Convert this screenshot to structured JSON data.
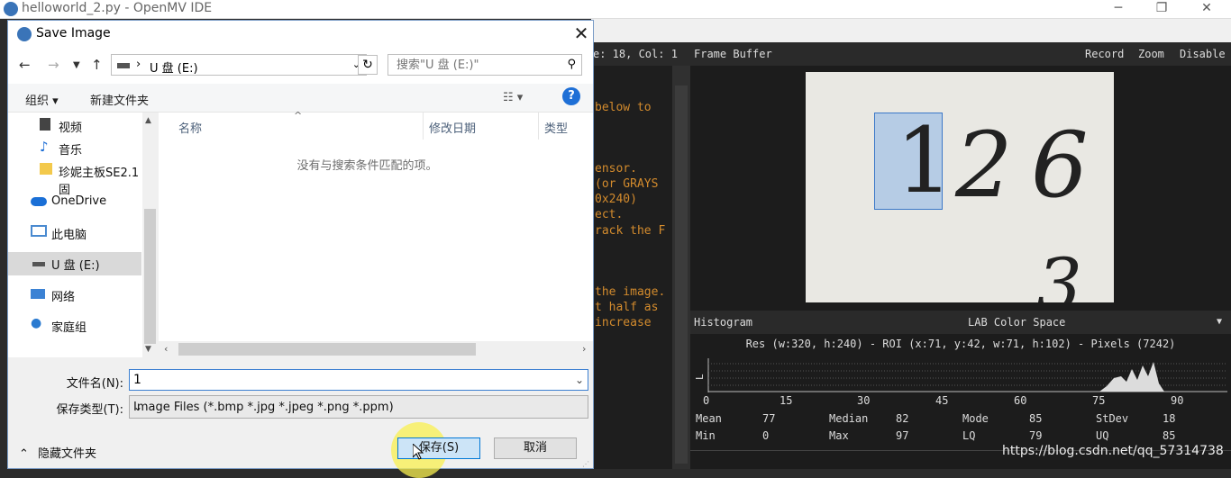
{
  "ide": {
    "title": "helloworld_2.py - OpenMV IDE",
    "status": "e: 18, Col: 1",
    "code_lines": [
      " below to",
      "ensor.",
      " (or GRAYS",
      "0x240)",
      "ect.",
      "rack the F",
      "the image.",
      "t half as",
      " increase"
    ],
    "frame_buffer": {
      "title": "Frame Buffer",
      "record": "Record",
      "zoom": "Zoom",
      "disable": "Disable",
      "digits": [
        "1",
        "2",
        "6",
        "3"
      ]
    },
    "histogram": {
      "title": "Histogram",
      "color_space": "LAB Color Space",
      "res_line": "Res (w:320, h:240) - ROI (x:71, y:42, w:71, h:102) - Pixels (7242)",
      "channel_label": "L",
      "ticks": [
        "0",
        "15",
        "30",
        "45",
        "60",
        "75",
        "90"
      ],
      "stats": {
        "mean_label": "Mean",
        "mean": "77",
        "median_label": "Median",
        "median": "82",
        "mode_label": "Mode",
        "mode": "85",
        "stdev_label": "StDev",
        "stdev": "18",
        "min_label": "Min",
        "min": "0",
        "max_label": "Max",
        "max": "97",
        "lq_label": "LQ",
        "lq": "79",
        "uq_label": "UQ",
        "uq": "85"
      }
    },
    "watermark": "https://blog.csdn.net/qq_57314738"
  },
  "dialog": {
    "title": "Save Image",
    "address_path": "U 盘 (E:)",
    "search_placeholder": "搜索\"U 盘 (E:)\"",
    "organize": "组织 ▾",
    "new_folder": "新建文件夹",
    "nav_items": [
      {
        "label": "视频",
        "icon": "video-icon"
      },
      {
        "label": "音乐",
        "icon": "music-icon"
      },
      {
        "label": "珍妮主板SE2.1固",
        "icon": "folder-icon"
      },
      {
        "label": "OneDrive",
        "icon": "cloud-icon"
      },
      {
        "label": "此电脑",
        "icon": "computer-icon"
      },
      {
        "label": "U 盘 (E:)",
        "icon": "drive-icon"
      },
      {
        "label": "网络",
        "icon": "network-icon"
      },
      {
        "label": "家庭组",
        "icon": "homegroup-icon"
      }
    ],
    "columns": {
      "name": "名称",
      "date": "修改日期",
      "type": "类型"
    },
    "empty_message": "没有与搜索条件匹配的项。",
    "filename_label": "文件名(N):",
    "filename_value": "1",
    "filetype_label": "保存类型(T):",
    "filetype_value": "Image Files (*.bmp *.jpg *.jpeg *.png *.ppm)",
    "hide_folders": "隐藏文件夹",
    "save_button": "保存(S)",
    "cancel_button": "取消"
  },
  "colors": {
    "accent": "#0078d7",
    "code": "#d38b2d",
    "roi": "#3b78c8"
  }
}
